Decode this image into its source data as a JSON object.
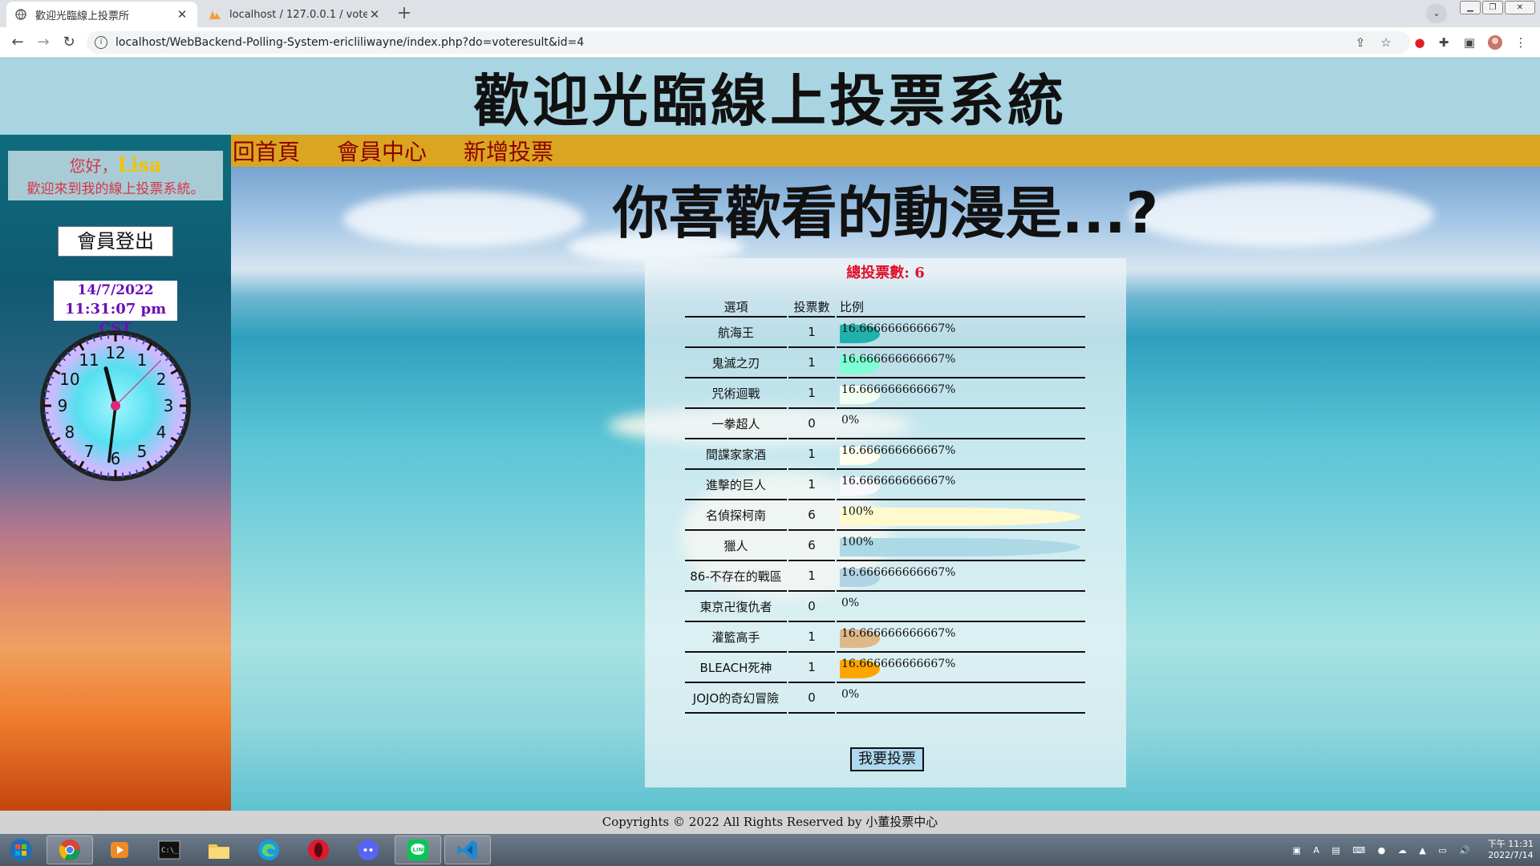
{
  "browser": {
    "tabs": [
      {
        "title": "歡迎光臨線上投票所",
        "active": true
      },
      {
        "title": "localhost / 127.0.0.1 / votesyste",
        "active": false
      }
    ],
    "url": "localhost/WebBackend-Polling-System-ericliliwayne/index.php?do=voteresult&id=4"
  },
  "header": {
    "title": "歡迎光臨線上投票系統"
  },
  "sidebar": {
    "greeting_prefix": "您好，",
    "user_name": "Lisa",
    "welcome": "歡迎來到我的線上投票系統。",
    "logout_label": "會員登出",
    "date": "14/7/2022",
    "time": "11:31:07 pm CST",
    "clock": {
      "hour": 11,
      "minute": 31,
      "second": 7,
      "numbers": [
        "12",
        "1",
        "2",
        "3",
        "4",
        "5",
        "6",
        "7",
        "8",
        "9",
        "10",
        "11"
      ]
    }
  },
  "nav": {
    "items": [
      "回首頁",
      "會員中心",
      "新增投票"
    ]
  },
  "poll": {
    "question": "你喜歡看的動漫是...?",
    "total_label": "總投票數: 6",
    "headers": {
      "option": "選項",
      "count": "投票數",
      "ratio": "比例"
    },
    "rows": [
      {
        "option": "航海王",
        "count": "1",
        "percent_text": "16.666666666667%",
        "fraction": 0.1667,
        "color": "#20b2aa"
      },
      {
        "option": "鬼滅之刃",
        "count": "1",
        "percent_text": "16.666666666667%",
        "fraction": 0.1667,
        "color": "#7fffd4"
      },
      {
        "option": "咒術迴戰",
        "count": "1",
        "percent_text": "16.666666666667%",
        "fraction": 0.1667,
        "color": "#f0fff0"
      },
      {
        "option": "一拳超人",
        "count": "0",
        "percent_text": "0%",
        "fraction": 0,
        "color": "#ffe4c4"
      },
      {
        "option": "間諜家家酒",
        "count": "1",
        "percent_text": "16.666666666667%",
        "fraction": 0.1667,
        "color": "#fffff0"
      },
      {
        "option": "進擊的巨人",
        "count": "1",
        "percent_text": "16.666666666667%",
        "fraction": 0.1667,
        "color": "#f8f8ff"
      },
      {
        "option": "名偵探柯南",
        "count": "6",
        "percent_text": "100%",
        "fraction": 1.0,
        "color": "#fffacd"
      },
      {
        "option": "獵人",
        "count": "6",
        "percent_text": "100%",
        "fraction": 1.0,
        "color": "#add8e6"
      },
      {
        "option": "86-不存在的戰區",
        "count": "1",
        "percent_text": "16.666666666667%",
        "fraction": 0.1667,
        "color": "#b0d4e6"
      },
      {
        "option": "東京卍復仇者",
        "count": "0",
        "percent_text": "0%",
        "fraction": 0,
        "color": "#d2b48c"
      },
      {
        "option": "灌籃高手",
        "count": "1",
        "percent_text": "16.666666666667%",
        "fraction": 0.1667,
        "color": "#deb887"
      },
      {
        "option": "BLEACH死神",
        "count": "1",
        "percent_text": "16.666666666667%",
        "fraction": 0.1667,
        "color": "#ffa500"
      },
      {
        "option": "JOJO的奇幻冒險",
        "count": "0",
        "percent_text": "0%",
        "fraction": 0,
        "color": "#ffffff"
      }
    ],
    "vote_button": "我要投票"
  },
  "footer": {
    "text": "Copyrights © 2022 All Rights Reserved by 小董投票中心"
  },
  "taskbar": {
    "time": "下午 11:31",
    "date": "2022/7/14"
  }
}
